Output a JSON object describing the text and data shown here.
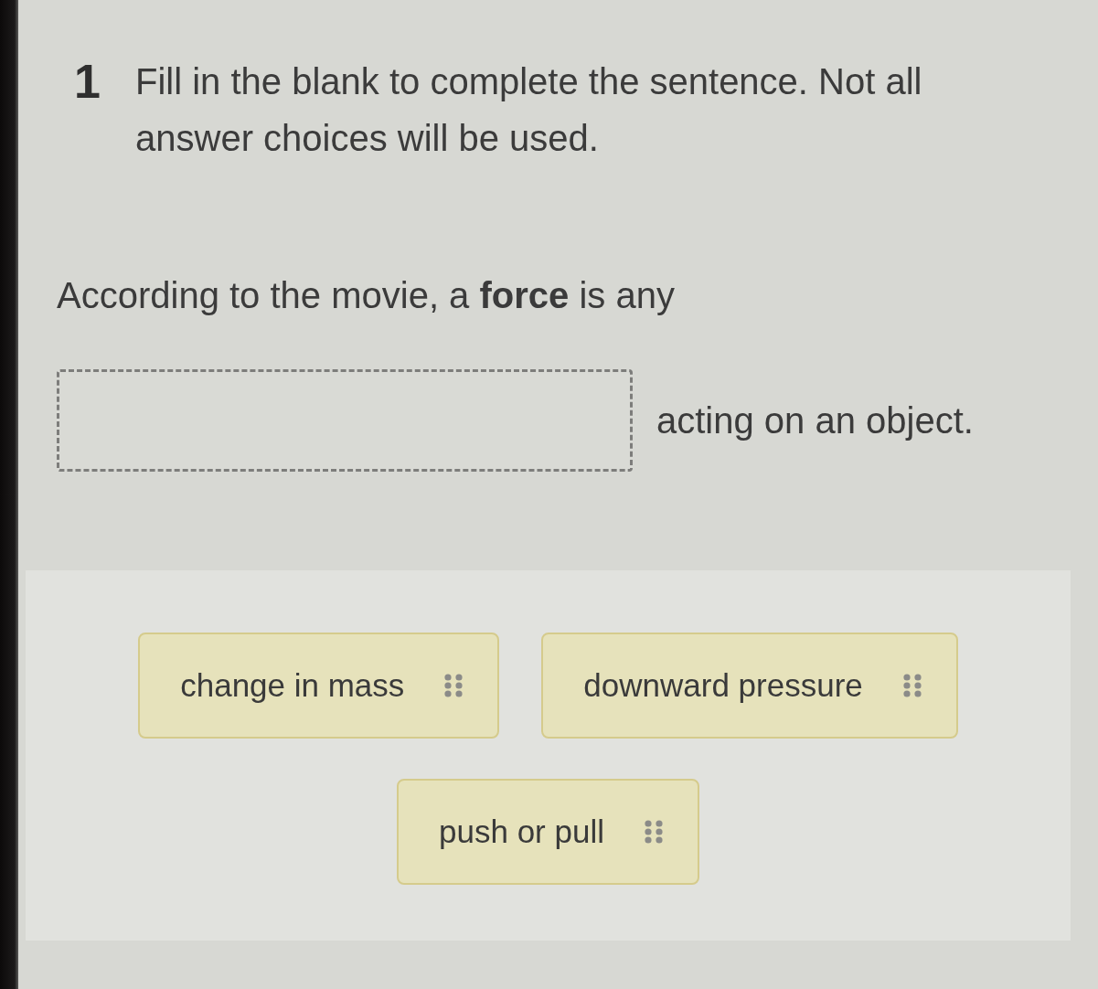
{
  "question": {
    "number": "1",
    "instruction": "Fill in the blank to complete the sentence. Not all answer choices will be used."
  },
  "sentence": [
    {
      "kind": "text",
      "text": "According to the movie, a **force** is any"
    },
    {
      "kind": "blank"
    },
    {
      "kind": "text",
      "text": "acting on an object."
    }
  ],
  "answer_choices": [
    {
      "label": "change in mass"
    },
    {
      "label": "downward pressure"
    },
    {
      "label": "push or pull"
    }
  ]
}
